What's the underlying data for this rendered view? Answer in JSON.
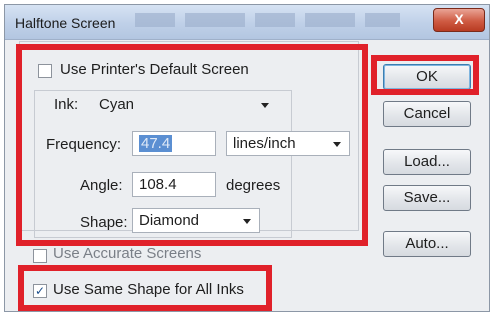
{
  "dialog": {
    "title": "Halftone Screen",
    "close_label": "X"
  },
  "options": {
    "use_printer_default_screen": {
      "label": "Use Printer's Default Screen",
      "checked": false
    },
    "use_accurate_screens": {
      "label": "Use Accurate Screens",
      "checked": false
    },
    "use_same_shape": {
      "label": "Use Same Shape for All Inks",
      "checked": true,
      "check_glyph": "✓"
    }
  },
  "ink": {
    "label": "Ink:",
    "value": "Cyan"
  },
  "frequency": {
    "label": "Frequency:",
    "value": "47.4",
    "unit": "lines/inch"
  },
  "angle": {
    "label": "Angle:",
    "value": "108.4",
    "unit": "degrees"
  },
  "shape": {
    "label": "Shape:",
    "value": "Diamond"
  },
  "buttons": {
    "ok": "OK",
    "cancel": "Cancel",
    "load": "Load...",
    "save": "Save...",
    "auto": "Auto..."
  },
  "highlight_color": "#e0212a"
}
